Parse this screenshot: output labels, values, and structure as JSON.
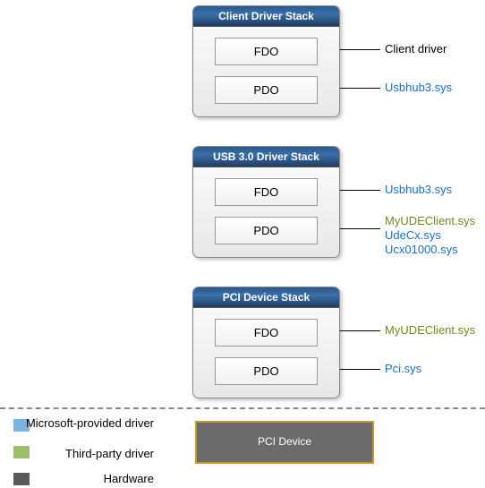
{
  "stacks": [
    {
      "title": "Client Driver Stack",
      "fdo": "FDO",
      "pdo": "PDO"
    },
    {
      "title": "USB 3.0 Driver Stack",
      "fdo": "FDO",
      "pdo": "PDO"
    },
    {
      "title": "PCI Device Stack",
      "fdo": "FDO",
      "pdo": "PDO"
    }
  ],
  "labels": {
    "client_fdo": "Client driver",
    "client_pdo": "Usbhub3.sys",
    "usb_fdo": "Usbhub3.sys",
    "usb_pdo_1": "MyUDEClient.sys",
    "usb_pdo_2": "UdeCx.sys",
    "usb_pdo_3": "Ucx01000.sys",
    "pci_fdo": "MyUDEClient.sys",
    "pci_pdo": "Pci.sys"
  },
  "legend": {
    "ms": "Microsoft-provided driver",
    "tp": "Third-party driver",
    "hw": "Hardware"
  },
  "hardware": "PCI Device",
  "colors": {
    "blue": "#1b6fc2",
    "olive": "#6a8a1f"
  }
}
